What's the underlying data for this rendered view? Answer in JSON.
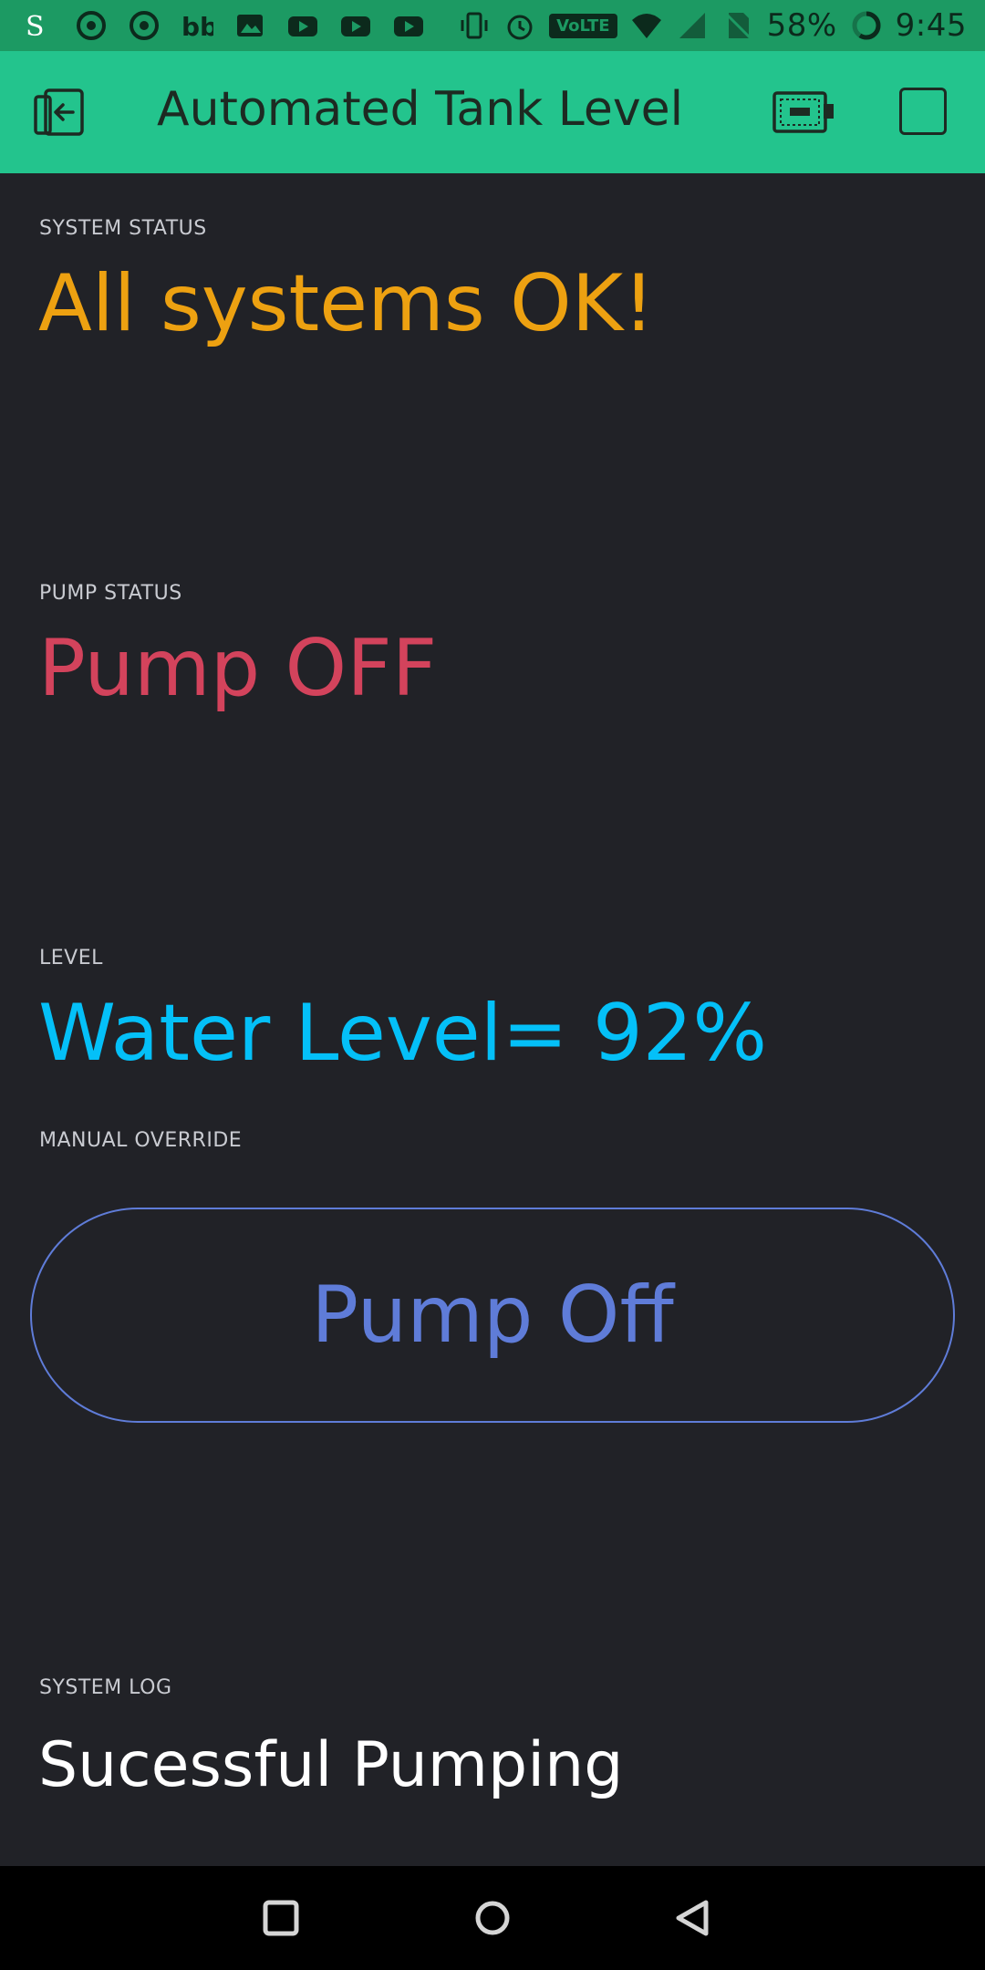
{
  "status_bar": {
    "battery_percent": "58%",
    "time": "9:45",
    "volte_label": "VoLTE",
    "notification_icons": [
      "s-app-icon",
      "chrome-icon",
      "chrome-icon",
      "bb-icon",
      "gallery-icon",
      "youtube-icon",
      "youtube-icon",
      "youtube-icon"
    ],
    "system_icons": [
      "vibrate-icon",
      "alarm-icon",
      "volte-icon",
      "wifi-icon",
      "signal-icon",
      "no-sim-icon",
      "battery-icon"
    ]
  },
  "header": {
    "title": "Automated Tank Level",
    "accent_color": "#23c48d"
  },
  "widgets": {
    "system_status": {
      "label": "SYSTEM STATUS",
      "value": "All systems OK!",
      "color": "#eda111"
    },
    "pump_status": {
      "label": "PUMP STATUS",
      "value": "Pump OFF",
      "color": "#d3435c"
    },
    "level": {
      "label": "LEVEL",
      "value": "Water Level= 92%",
      "color": "#04c0f8"
    },
    "manual_override": {
      "label": "MANUAL OVERRIDE",
      "button_label": "Pump Off",
      "color": "#5f7cd8"
    },
    "system_log": {
      "label": "SYSTEM LOG",
      "value": "Sucessful Pumping"
    }
  },
  "navbar": {
    "icons": [
      "recents-icon",
      "home-icon",
      "back-icon"
    ]
  }
}
